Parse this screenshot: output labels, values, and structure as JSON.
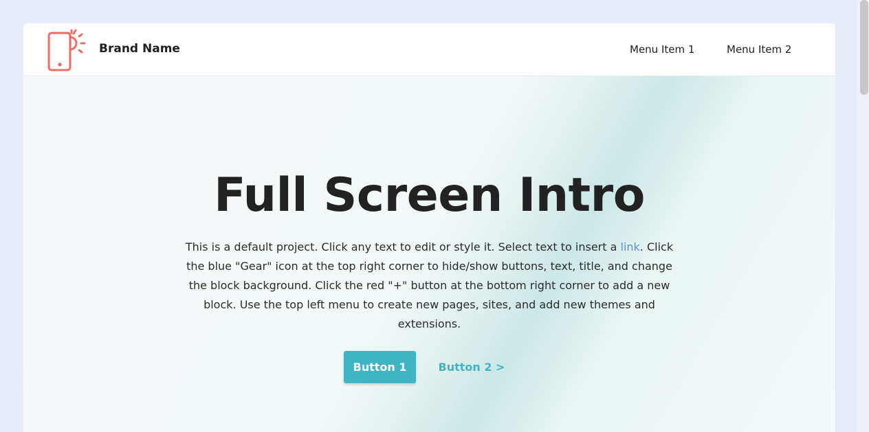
{
  "navbar": {
    "brand_name": "Brand Name",
    "logo_icon": "phone-sun-icon",
    "menu_items": [
      {
        "label": "Menu Item 1"
      },
      {
        "label": "Menu Item 2"
      }
    ]
  },
  "hero": {
    "title": "Full Screen Intro",
    "text_before_link": "This is a default project. Click any text to edit or style it. Select text to insert a ",
    "link_label": "link",
    "text_after_link": ". Click the blue \"Gear\" icon at the top right corner to hide/show buttons, text, title, and change the block background. Click the red \"+\" button at the bottom right corner to add a new block. Use the top left menu to create new pages, sites, and add new themes and extensions.",
    "primary_button_label": "Button 1",
    "secondary_button_label": "Button 2 >"
  },
  "colors": {
    "page_background": "#e8edf9",
    "logo": "#ef6b64",
    "accent": "#41b4c2",
    "link": "#5b8fd6",
    "text": "#222222"
  }
}
